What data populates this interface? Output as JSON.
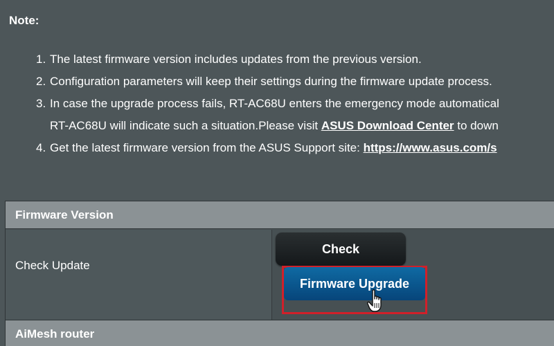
{
  "note": {
    "title": "Note:",
    "items": [
      {
        "num": "1.",
        "text": "The latest firmware version includes updates from the previous version."
      },
      {
        "num": "2.",
        "text": "Configuration parameters will keep their settings during the firmware update process."
      },
      {
        "num": "3.",
        "text": "In case the upgrade process fails, RT-AC68U enters the emergency mode automatical"
      },
      {
        "text_before": "RT-AC68U will indicate such a situation.Please visit ",
        "link": "ASUS Download Center",
        "text_after": " to down"
      },
      {
        "num": "4.",
        "text": "Get the latest firmware version from the ASUS Support site: ",
        "link": "https://www.asus.com/s"
      }
    ]
  },
  "firmware": {
    "header": "Firmware Version",
    "row_label": "Check Update",
    "check_label": "Check",
    "upgrade_label": "Firmware Upgrade",
    "highlight_color": "#d0202a"
  },
  "aimesh": {
    "header": "AiMesh router"
  },
  "icons": {
    "cursor": "hand-pointer-icon"
  }
}
